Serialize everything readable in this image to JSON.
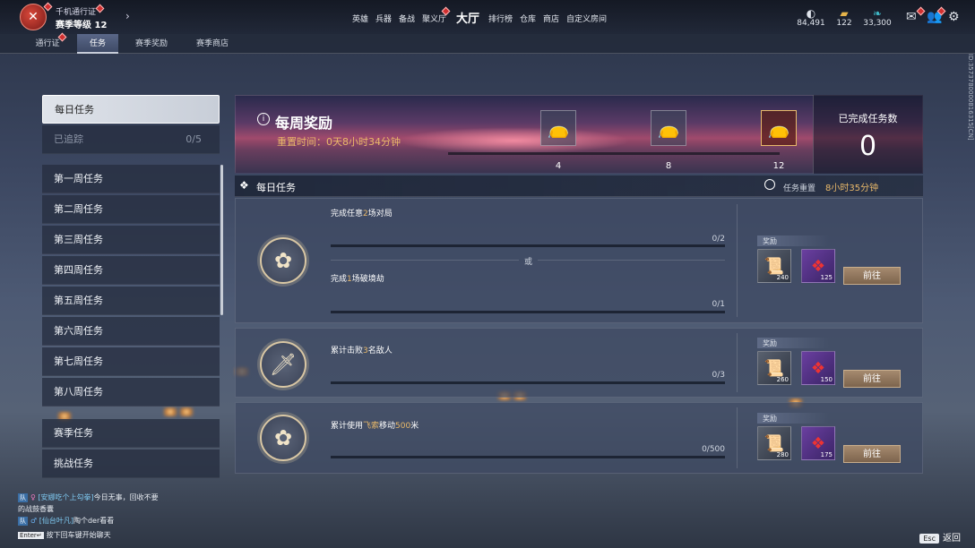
{
  "header": {
    "player_name": "千机通行证",
    "season_level": "赛季等级 12",
    "nav": [
      "英雄",
      "兵器",
      "备战",
      "聚义厅",
      "大厅",
      "排行榜",
      "仓库",
      "商店",
      "自定义房间"
    ],
    "currencies": [
      {
        "icon": "mask-coin-icon",
        "value": "84,491"
      },
      {
        "icon": "gold-ingot-icon",
        "value": "122"
      },
      {
        "icon": "jade-leaf-icon",
        "value": "33,300"
      }
    ]
  },
  "subtabs": [
    "通行证",
    "任务",
    "赛季奖励",
    "赛季商店"
  ],
  "sidebar": {
    "items": [
      {
        "label": "每日任务",
        "active": true
      },
      {
        "label": "已追踪",
        "count": "0/5"
      },
      {
        "label": "第一周任务"
      },
      {
        "label": "第二周任务"
      },
      {
        "label": "第三周任务"
      },
      {
        "label": "第四周任务"
      },
      {
        "label": "第五周任务"
      },
      {
        "label": "第六周任务"
      },
      {
        "label": "第七周任务"
      },
      {
        "label": "第八周任务"
      },
      {
        "label": "赛季任务"
      },
      {
        "label": "挑战任务"
      }
    ]
  },
  "weekly": {
    "title": "每周奖励",
    "reset": "重置时间：0天8小时34分钟",
    "milestones": [
      "4",
      "8",
      "12"
    ],
    "progress": 0,
    "completed_label": "已完成任务数",
    "completed_count": "0"
  },
  "daily": {
    "title": "每日任务",
    "reset_label": "任务重置",
    "reset_time": "8小时35分钟"
  },
  "tasks": [
    {
      "lines": [
        {
          "pre": "完成任意",
          "hl": "2",
          "post": "场对局",
          "count": "0/2",
          "progress": 0
        },
        {
          "pre": "完成",
          "hl": "1",
          "post": "场破境劫",
          "count": "0/1",
          "progress": 0
        }
      ],
      "or": "或",
      "reward_label": "奖励",
      "rewards": [
        "240",
        "125"
      ],
      "button": "前往"
    },
    {
      "lines": [
        {
          "pre": "累计击败",
          "hl": "3",
          "post": "名敌人",
          "count": "0/3",
          "progress": 0
        }
      ],
      "reward_label": "奖励",
      "rewards": [
        "260",
        "150"
      ],
      "button": "前往"
    },
    {
      "lines": [
        {
          "pre": "累计使用",
          "hl": "飞索",
          "post": "移动",
          "hl2": "500",
          "post2": "米",
          "count": "0/500",
          "progress": 0
        }
      ],
      "reward_label": "奖励",
      "rewards": [
        "280",
        "175"
      ],
      "button": "前往"
    }
  ],
  "chat": [
    {
      "tag": "队",
      "name": "[安娜吃个上勾拳]",
      "msg": "今日无事，回收不要"
    },
    {
      "tag": "",
      "name": "",
      "msg": "的战鼓香囊"
    },
    {
      "tag": "队",
      "name": "[仙台叶凡]",
      "msg": "陶个der看看"
    },
    {
      "tag": "Enter↵",
      "name": "",
      "msg": "按下回车键开始聊天"
    }
  ],
  "vertical_id": "ID:3573780000816315[CN]",
  "esc": {
    "key": "Esc",
    "label": "返回"
  }
}
